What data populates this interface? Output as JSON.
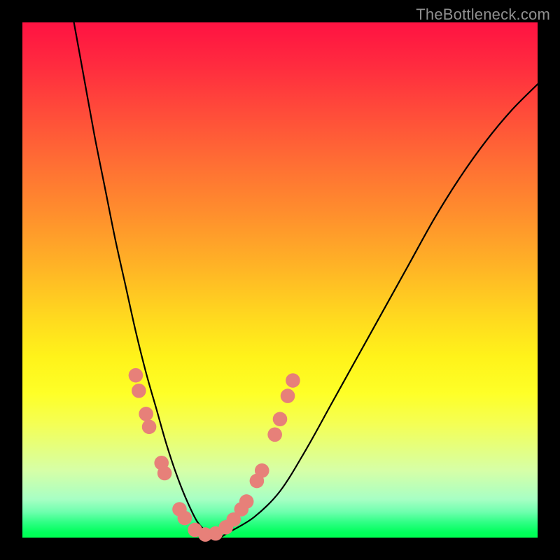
{
  "watermark": "TheBottleneck.com",
  "chart_data": {
    "type": "line",
    "title": "",
    "xlabel": "",
    "ylabel": "",
    "xlim": [
      0,
      100
    ],
    "ylim": [
      0,
      100
    ],
    "grid": false,
    "gradient_stops": [
      {
        "pct": 0,
        "color": "#ff1242"
      },
      {
        "pct": 8,
        "color": "#ff2a3f"
      },
      {
        "pct": 17,
        "color": "#ff4a3a"
      },
      {
        "pct": 27,
        "color": "#ff6d34"
      },
      {
        "pct": 37,
        "color": "#ff8e2d"
      },
      {
        "pct": 47,
        "color": "#ffb226"
      },
      {
        "pct": 57,
        "color": "#ffd81f"
      },
      {
        "pct": 65,
        "color": "#fff31a"
      },
      {
        "pct": 72,
        "color": "#feff27"
      },
      {
        "pct": 78,
        "color": "#f4ff55"
      },
      {
        "pct": 87,
        "color": "#d6ffa7"
      },
      {
        "pct": 92.5,
        "color": "#a8ffc4"
      },
      {
        "pct": 95,
        "color": "#6fffae"
      },
      {
        "pct": 97,
        "color": "#30ff85"
      },
      {
        "pct": 99,
        "color": "#00ff5c"
      },
      {
        "pct": 100,
        "color": "#00ff52"
      }
    ],
    "series": [
      {
        "name": "bottleneck-curve",
        "color": "#000000",
        "x": [
          10,
          12,
          14,
          16,
          18,
          20,
          22,
          24,
          26,
          28,
          30,
          32,
          34,
          36,
          38,
          40,
          45,
          50,
          55,
          60,
          65,
          70,
          75,
          80,
          85,
          90,
          95,
          100
        ],
        "y": [
          100,
          89,
          78,
          68,
          58,
          49,
          40,
          32,
          25,
          18,
          12,
          7,
          3,
          1,
          0,
          1,
          4,
          9,
          17,
          26,
          35,
          44,
          53,
          62,
          70,
          77,
          83,
          88
        ]
      }
    ],
    "markers": {
      "name": "highlight-dots",
      "color": "#e78079",
      "radius_pct": 1.4,
      "points": [
        {
          "x": 22.0,
          "y": 31.5
        },
        {
          "x": 22.6,
          "y": 28.5
        },
        {
          "x": 24.0,
          "y": 24.0
        },
        {
          "x": 24.6,
          "y": 21.5
        },
        {
          "x": 27.0,
          "y": 14.5
        },
        {
          "x": 27.6,
          "y": 12.5
        },
        {
          "x": 30.5,
          "y": 5.5
        },
        {
          "x": 31.5,
          "y": 3.8
        },
        {
          "x": 33.5,
          "y": 1.5
        },
        {
          "x": 35.5,
          "y": 0.6
        },
        {
          "x": 37.5,
          "y": 0.8
        },
        {
          "x": 39.5,
          "y": 2.0
        },
        {
          "x": 41.0,
          "y": 3.5
        },
        {
          "x": 42.5,
          "y": 5.5
        },
        {
          "x": 43.5,
          "y": 7.0
        },
        {
          "x": 45.5,
          "y": 11.0
        },
        {
          "x": 46.5,
          "y": 13.0
        },
        {
          "x": 49.0,
          "y": 20.0
        },
        {
          "x": 50.0,
          "y": 23.0
        },
        {
          "x": 51.5,
          "y": 27.5
        },
        {
          "x": 52.5,
          "y": 30.5
        }
      ]
    }
  }
}
